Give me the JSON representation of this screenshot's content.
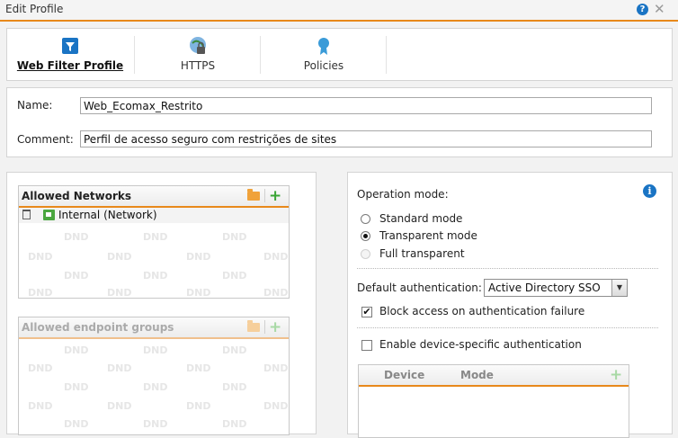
{
  "window": {
    "title": "Edit Profile",
    "help_symbol": "?",
    "close_symbol": "✕"
  },
  "tabs": [
    {
      "label": "Web Filter Profile",
      "icon": "filter-icon",
      "active": true
    },
    {
      "label": "HTTPS",
      "icon": "https-lock-icon",
      "active": false
    },
    {
      "label": "Policies",
      "icon": "policy-ribbon-icon",
      "active": false
    }
  ],
  "form": {
    "name_label": "Name:",
    "name_value": "Web_Ecomax_Restrito",
    "comment_label": "Comment:",
    "comment_value": "Perfil de acesso seguro com restrições de sites"
  },
  "allowed_networks": {
    "title": "Allowed Networks",
    "items": [
      "Internal (Network)"
    ]
  },
  "allowed_endpoint_groups": {
    "title": "Allowed endpoint groups",
    "items": []
  },
  "dnd_watermark": "DND",
  "operation_mode": {
    "label": "Operation mode:",
    "info_symbol": "i",
    "options": [
      {
        "label": "Standard mode",
        "checked": false,
        "disabled": false
      },
      {
        "label": "Transparent mode",
        "checked": true,
        "disabled": false
      },
      {
        "label": "Full transparent",
        "checked": false,
        "disabled": true
      }
    ]
  },
  "default_auth": {
    "label": "Default authentication:",
    "selected": "Active Directory SSO",
    "arrow": "▼"
  },
  "block_on_failure": {
    "label": "Block access on authentication failure",
    "checked": true,
    "mark": "✔"
  },
  "device_specific_auth": {
    "label": "Enable device-specific authentication",
    "checked": false
  },
  "device_table": {
    "columns": [
      "Device",
      "Mode"
    ],
    "add_symbol": "+"
  },
  "colors": {
    "accent": "#e8891b",
    "add_green": "#3aa535",
    "info_blue": "#1a74c4"
  }
}
